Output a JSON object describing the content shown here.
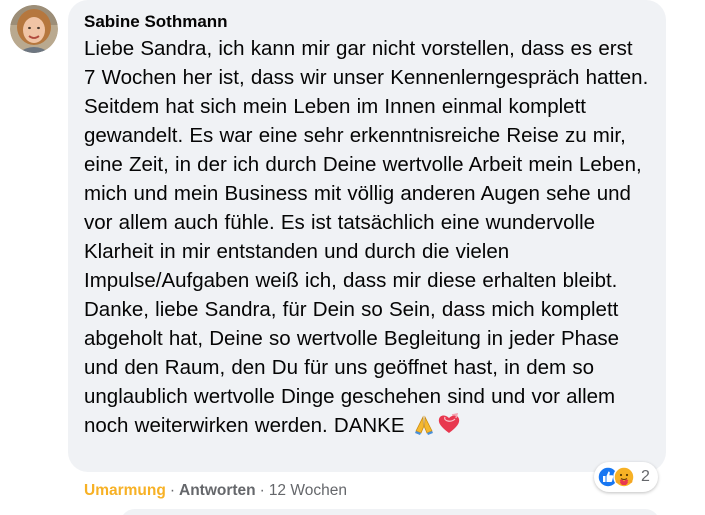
{
  "comment": {
    "author": "Sabine Sothmann",
    "text": "Liebe Sandra, ich kann mir gar nicht vorstellen, dass es erst 7 Wochen her ist, dass wir unser Kennenlerngespräch hatten. Seitdem hat sich mein Leben im Innen einmal komplett gewandelt. Es war eine sehr erkenntnisreiche Reise zu mir, eine Zeit, in der ich durch Deine wertvolle Arbeit mein Leben, mich und mein Business mit völlig anderen Augen sehe und vor allem auch fühle. Es ist tatsächlich eine wundervolle Klarheit in mir entstanden und durch die vielen Impulse/Aufgaben weiß ich, dass mir diese erhalten bleibt. Danke, liebe Sandra, für Dein so Sein, dass mich komplett abgeholt hat, Deine so wertvolle Begleitung in jeder Phase und den Raum, den Du für uns geöffnet hast, in dem so unglaublich wertvolle Dinge geschehen sind und vor allem noch weiterwirken werden. DANKE",
    "emojis": [
      "folded-hands-emoji",
      "heart-with-ribbon-emoji"
    ]
  },
  "reactions": {
    "icons": [
      "like-icon",
      "care-icon"
    ],
    "count": "2"
  },
  "actions": {
    "reaction_label": "Umarmung",
    "separator": "·",
    "reply_label": "Antworten",
    "timestamp": "12 Wochen"
  },
  "colors": {
    "bubble": "#f0f2f5",
    "reaction_accent": "#f7b125",
    "like_blue": "#1877f2",
    "text": "#050505",
    "secondary": "#65676b"
  }
}
